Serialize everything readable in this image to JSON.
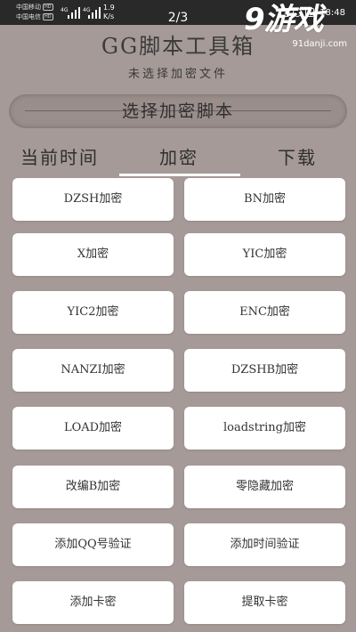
{
  "status_bar": {
    "carrier1": "中国移动",
    "carrier2": "中国电信",
    "hd": "HD",
    "net1": "4G",
    "net2": "4G",
    "speed_value": "1.9",
    "speed_unit": "K/s",
    "time": "18:48"
  },
  "page_indicator": "2/3",
  "watermark": {
    "logo": "9游戏",
    "url": "91danji.com"
  },
  "header": {
    "title": "GG脚本工具箱",
    "subtitle": "未选择加密文件"
  },
  "select_button_label": "选择加密脚本",
  "tabs": [
    {
      "label": "当前时间"
    },
    {
      "label": "加密"
    },
    {
      "label": "下载"
    }
  ],
  "active_tab": "加密",
  "cards": [
    {
      "label": "DZSH加密"
    },
    {
      "label": "BN加密"
    },
    {
      "label": "X加密"
    },
    {
      "label": "YIC加密"
    },
    {
      "label": "YIC2加密"
    },
    {
      "label": "ENC加密"
    },
    {
      "label": "NANZI加密"
    },
    {
      "label": "DZSHB加密"
    },
    {
      "label": "LOAD加密"
    },
    {
      "label": "loadstring加密"
    },
    {
      "label": "改编B加密"
    },
    {
      "label": "零隐藏加密"
    },
    {
      "label": "添加QQ号验证"
    },
    {
      "label": "添加时间验证"
    },
    {
      "label": "添加卡密"
    },
    {
      "label": "提取卡密"
    }
  ]
}
